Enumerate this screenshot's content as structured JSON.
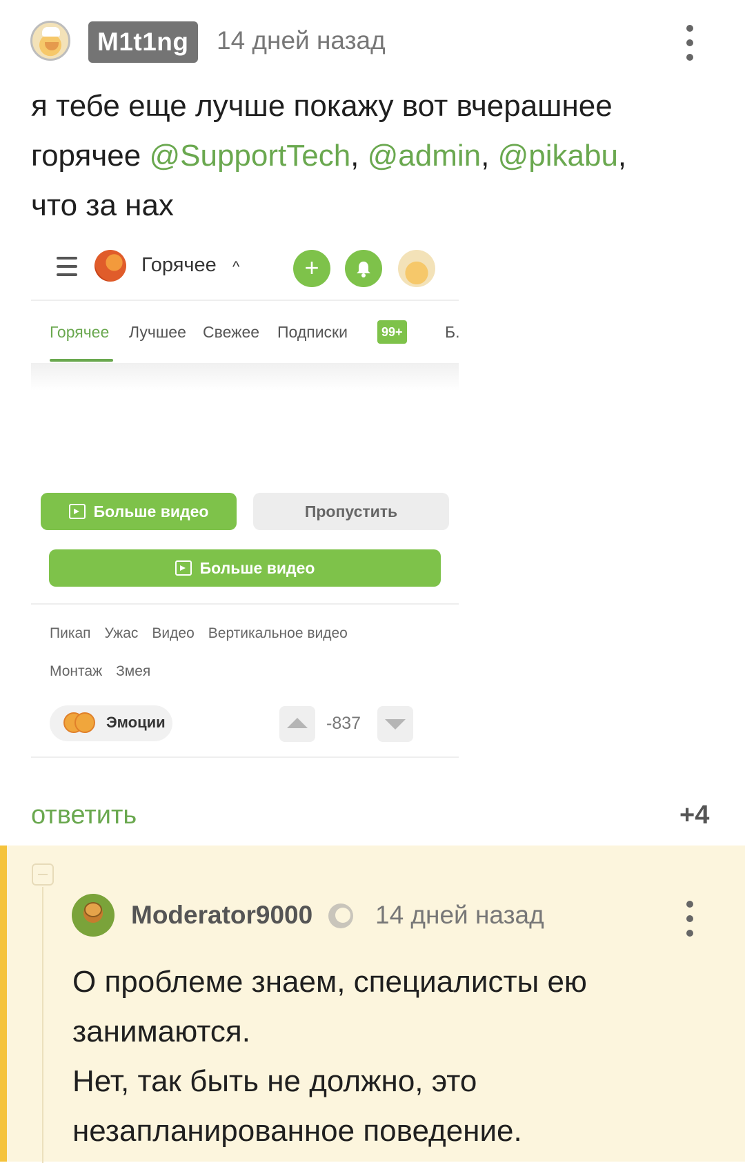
{
  "comment": {
    "username": "M1t1ng",
    "time": "14 дней назад",
    "text_line1": "я тебе еще лучше покажу вот вчерашнее",
    "text_line2_prefix": "горячее ",
    "mentions": [
      "@SupportTech",
      "@admin",
      "@pikabu"
    ],
    "comma": ", ",
    "trailing_comma": ",",
    "text_line3": "что за нах",
    "reply_label": "ответить",
    "rating": "+4"
  },
  "screenshot": {
    "header_title": "Горячее",
    "chevron": "^",
    "add_icon": "+",
    "tabs": [
      "Горячее",
      "Лучшее",
      "Свежее",
      "Подписки",
      "Б."
    ],
    "subscriptions_badge": "99+",
    "more_video_label": "Больше видео",
    "skip_label": "Пропустить",
    "tags_row1": [
      "Пикап",
      "Ужас",
      "Видео",
      "Вертикальное видео"
    ],
    "tags_row2": [
      "Монтаж",
      "Змея"
    ],
    "emotions_label": "Эмоции",
    "vote_count": "-837"
  },
  "reply": {
    "username": "Moderator9000",
    "time": "14 дней назад",
    "line1": "О проблеме знаем, специалисты ею",
    "line2": "занимаются.",
    "line3": "Нет, так быть не должно, это",
    "line4": "незапланированное поведение."
  },
  "colors": {
    "accent_green": "#6aa84f",
    "button_green": "#7ec24a",
    "reply_background": "#fcf5dd",
    "reply_bar": "#f5c33b"
  }
}
